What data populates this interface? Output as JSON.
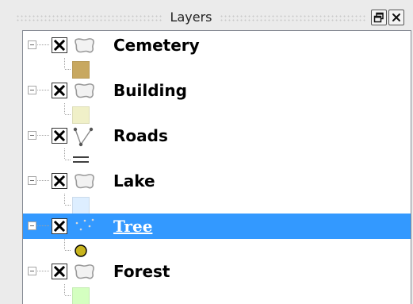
{
  "panel": {
    "title": "Layers"
  },
  "layers": [
    {
      "name": "Cemetery",
      "geometry": "polygon",
      "checked": true,
      "selected": false,
      "symbol_type": "fill",
      "symbol_color": "#c8a860"
    },
    {
      "name": "Building",
      "geometry": "polygon",
      "checked": true,
      "selected": false,
      "symbol_type": "fill",
      "symbol_color": "#f0f0c8"
    },
    {
      "name": "Roads",
      "geometry": "line",
      "checked": true,
      "selected": false,
      "symbol_type": "line",
      "symbol_color": "#000000"
    },
    {
      "name": "Lake",
      "geometry": "polygon",
      "checked": true,
      "selected": false,
      "symbol_type": "fill",
      "symbol_color": "#ddeeff"
    },
    {
      "name": "Tree",
      "geometry": "point",
      "checked": true,
      "selected": true,
      "symbol_type": "point",
      "symbol_color": "#c8b41e"
    },
    {
      "name": "Forest",
      "geometry": "polygon",
      "checked": true,
      "selected": false,
      "symbol_type": "fill",
      "symbol_color": "#d4ffc0"
    }
  ],
  "colors": {
    "selection": "#3399ff",
    "panel_bg": "#ebebeb",
    "tree_bg": "#ffffff"
  },
  "icons": {
    "float_button": "float-restore-icon",
    "close_button": "close-icon",
    "polygon_layer": "polygon-layer-icon",
    "line_layer": "line-layer-icon",
    "point_layer": "point-layer-icon"
  }
}
